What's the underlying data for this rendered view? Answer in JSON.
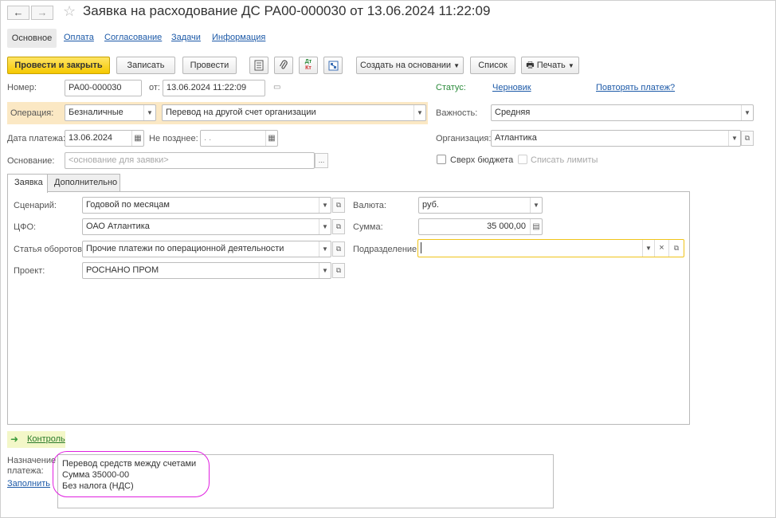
{
  "window": {
    "title": "Заявка на расходование ДС РА00-000030 от 13.06.2024 11:22:09",
    "back_label": "←",
    "forward_label": "→"
  },
  "top_tabs": {
    "main": "Основное",
    "payment": "Оплата",
    "approval": "Согласование",
    "tasks": "Задачи",
    "info": "Информация"
  },
  "toolbar": {
    "post_close": "Провести и закрыть",
    "write": "Записать",
    "post": "Провести",
    "dtkt_top": "Дт",
    "dtkt_bottom": "Кт",
    "create_based": "Создать на основании",
    "list": "Список",
    "print": "Печать"
  },
  "header": {
    "number_label": "Номер:",
    "number_value": "РА00-000030",
    "date_label": "от:",
    "date_value": "13.06.2024 11:22:09",
    "status_label": "Статус:",
    "status_value": "Черновик",
    "repeat_link": "Повторять платеж?",
    "operation_label": "Операция:",
    "operation_type": "Безналичные",
    "operation_value": "Перевод на другой счет организации",
    "importance_label": "Важность:",
    "importance_value": "Средняя",
    "pay_date_label": "Дата платежа:",
    "pay_date_value": "13.06.2024",
    "not_later_label": "Не позднее:",
    "not_later_value": " .  .",
    "org_label": "Организация:",
    "org_value": "Атлантика",
    "basis_label": "Основание:",
    "basis_placeholder": "<основание для заявки>",
    "over_budget_label": "Сверх бюджета",
    "write_off_limits_label": "Списать лимиты",
    "ellipsis": "..."
  },
  "inner_tabs": {
    "request": "Заявка",
    "additional": "Дополнительно"
  },
  "request_tab": {
    "scenario_label": "Сценарий:",
    "scenario_value": "Годовой по месяцам",
    "cfo_label": "ЦФО:",
    "cfo_value": "ОАО Атлантика",
    "turnover_label": "Статья оборотов:",
    "turnover_value": "Прочие платежи по операционной деятельности",
    "project_label": "Проект:",
    "project_value": "РОСНАНО ПРОМ",
    "currency_label": "Валюта:",
    "currency_value": "руб.",
    "amount_label": "Сумма:",
    "amount_value": "35 000,00",
    "division_label": "Подразделение:",
    "division_value": ""
  },
  "control": {
    "label": "Контроль"
  },
  "purpose": {
    "label": "Назначение платежа:",
    "fill_link": "Заполнить",
    "lines": [
      "Перевод средств между счетами",
      "Сумма 35000-00",
      "Без налога (НДС)"
    ]
  },
  "colors": {
    "accent_yellow": "#f5c800",
    "link_blue": "#1d5aa8",
    "status_green": "#2a8a3a",
    "focus_border": "#f0c419",
    "highlight_oval": "#e020e0"
  }
}
